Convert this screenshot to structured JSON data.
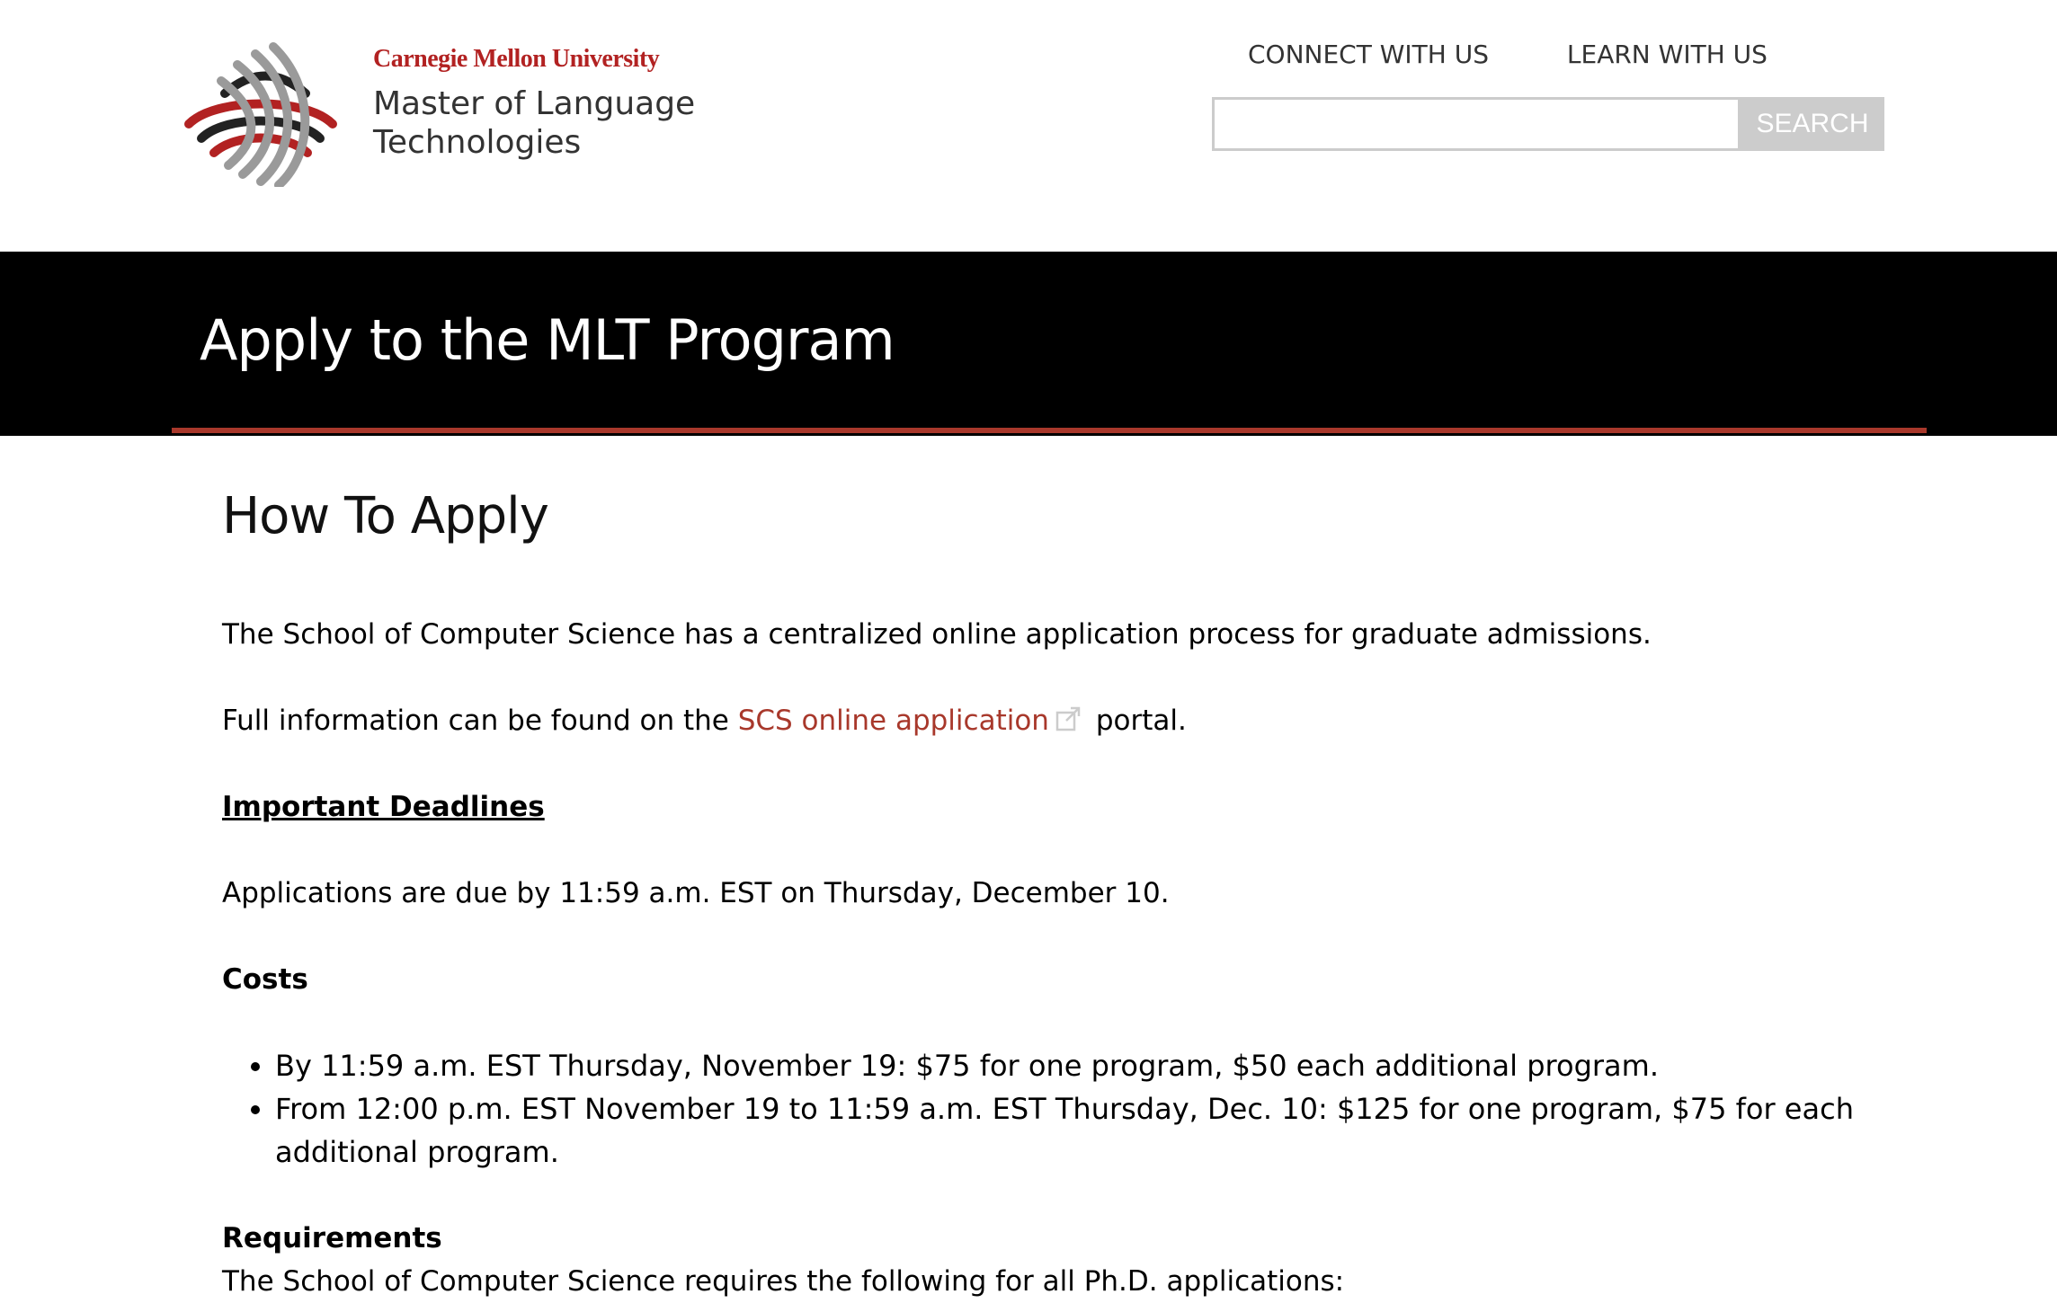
{
  "header": {
    "university": "Carnegie Mellon University",
    "site_name_line1": "Master of Language",
    "site_name_line2": "Technologies",
    "nav": [
      {
        "label": "CONNECT WITH US"
      },
      {
        "label": "LEARN WITH US"
      }
    ],
    "search": {
      "value": "",
      "placeholder": "",
      "button_label": "SEARCH"
    }
  },
  "hero": {
    "title": "Apply to the MLT Program"
  },
  "main": {
    "heading": "How To Apply",
    "intro": "The School of Computer Science has a centralized online application process for graduate admissions.",
    "info_prefix": "Full information can be found on the ",
    "info_link": "SCS online application",
    "info_suffix": " portal.",
    "deadlines_heading": "Important Deadlines",
    "deadlines_text": "Applications are due by 11:59 a.m. EST on Thursday, December 10.",
    "costs_heading": "Costs",
    "costs": [
      "By 11:59 a.m. EST Thursday, November 19: $75 for one program, $50 each additional program.",
      "From 12:00 p.m. EST November 19 to 11:59 a.m. EST Thursday, Dec. 10: $125 for one program, $75 for each additional program."
    ],
    "requirements_heading": "Requirements",
    "requirements_text": "The School of Computer Science requires the following for all Ph.D. applications:"
  },
  "colors": {
    "accent": "#a8382b",
    "hero_bg": "#000000",
    "search_button": "#cccccc"
  },
  "icons": [
    "cmu-logo-mark",
    "external-link-icon"
  ]
}
